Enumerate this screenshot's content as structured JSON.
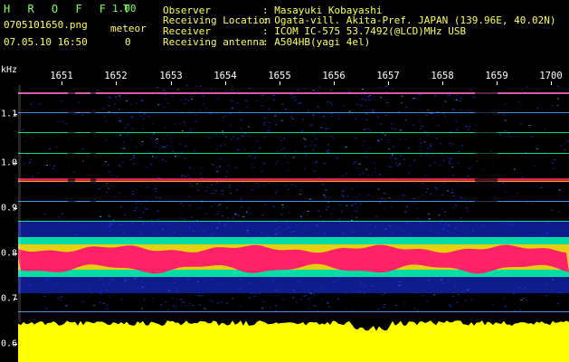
{
  "header": {
    "brand": "H R O F F T",
    "version": "1.00",
    "filename": "0705101650.png",
    "datetime": "07.05.10 16:50",
    "meteor_label": "meteor",
    "meteor_count": "0",
    "fields": [
      {
        "label": "Observer",
        "value": ": Masayuki Kobayashi"
      },
      {
        "label": "Receiving Location",
        "value": ": Ogata-vill. Akita-Pref. JAPAN (139.96E, 40.02N)"
      },
      {
        "label": "Receiver",
        "value": ": ICOM IC-575 53.7492(@LCD)MHz USB"
      },
      {
        "label": "Receiving antenna",
        "value": ": A504HB(yagi 4el)"
      }
    ]
  },
  "axis": {
    "unit": "kHz",
    "time_ticks": [
      "1651",
      "1652",
      "1653",
      "1654",
      "1655",
      "1656",
      "1657",
      "1658",
      "1659",
      "1700"
    ],
    "freq_ticks": [
      "1.1",
      "1.0",
      "0.9",
      "0.8",
      "0.7",
      "0.6"
    ]
  },
  "colors": {
    "background": "#000000",
    "header_green": "#7cff4c",
    "header_yellow": "#ffff55",
    "noise_floor": "#ffff00",
    "strong_signal": "#ff2266",
    "mid_signal": "#00ffaa",
    "weak_signal": "#1a33ff"
  }
}
